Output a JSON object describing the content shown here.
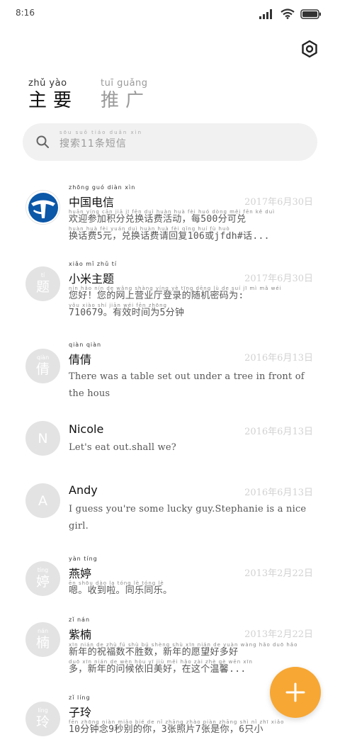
{
  "status_bar": {
    "time": "8:16",
    "icons": [
      "signal-icon",
      "wifi-icon",
      "battery-icon"
    ]
  },
  "header": {
    "settings_icon": "settings-icon"
  },
  "tabs": [
    {
      "pinyin": "zhǔ yào",
      "label": "主要"
    },
    {
      "pinyin": "tuī guǎng",
      "label": "推广"
    }
  ],
  "search": {
    "pinyin": "sōu suǒ    tiáo duǎn xìn",
    "placeholder": "搜索11条短信"
  },
  "messages": [
    {
      "avatar_text": "",
      "avatar_pinyin": "",
      "name_pinyin": "zhōng guó diàn xìn",
      "name": "中国电信",
      "date": "2017年6月30日",
      "preview_pinyin_1": "huān yíng cān jiā jī fēn duì huàn huà fèi huó dòng          měi              fēn kě duì",
      "preview_line_1": "欢迎参加积分兑换话费活动，每500分可兑",
      "preview_pinyin_2": "huàn huà fèi yuán   duì huàn huà fèi qǐng huí fù          huò",
      "preview_line_2": "换话费5元，兑换话费请回复106或jfdh#话..."
    },
    {
      "avatar_text": "题",
      "avatar_pinyin": "tí",
      "name_pinyin": "xiǎo mǐ zhǔ tí",
      "name": "小米主题",
      "date": "2017年6月30日",
      "preview_pinyin_1": "nín hǎo    nín de wǎng shàng yíng yè tīng dēng lù de suí jī mì mǎ wéi",
      "preview_line_1": "您好！您的网上营业厅登录的随机密码为:",
      "preview_pinyin_2": "          yǒu xiào shí jiān wéi    fēn zhōng",
      "preview_line_2": "710679。有效时间为5分钟"
    },
    {
      "avatar_text": "倩",
      "avatar_pinyin": "qiàn",
      "name_pinyin": "qiàn qiàn",
      "name": "倩倩",
      "date": "2016年6月13日",
      "preview_line_1": "There was a table set out under a tree in front of",
      "preview_line_2": "the hous"
    },
    {
      "avatar_text": "N",
      "name": "Nicole",
      "date": "2016年6月13日",
      "preview_line_1": "Let's eat out.shall we?"
    },
    {
      "avatar_text": "A",
      "name": "Andy",
      "date": "2016年6月13日",
      "preview_line_1": "I guess you're some lucky guy.Stephanie is a nice",
      "preview_line_2": "girl."
    },
    {
      "avatar_text": "婷",
      "avatar_pinyin": "tíng",
      "name_pinyin": "yàn tíng",
      "name": "燕婷",
      "date": "2013年2月22日",
      "preview_pinyin_1": "ēn   shōu dào la    tóng lè tóng lè",
      "preview_line_1": "嗯。收到啦。同乐同乐。"
    },
    {
      "avatar_text": "楠",
      "avatar_pinyin": "nán",
      "name_pinyin": "zǐ nán",
      "name": "紫楠",
      "date": "2013年2月22日",
      "preview_pinyin_1": "xīn nián de zhù fú shù bú shèng shù   xīn nián de yuàn wàng hǎo duō hǎo",
      "preview_line_1": "新年的祝福数不胜数，新年的愿望好多好",
      "preview_pinyin_2": "duō   xīn nián de wèn hòu yī jiù měi hǎo   zài zhè gè wēn xīn",
      "preview_line_2": "多，新年的问候依旧美好，在这个温馨..."
    },
    {
      "avatar_text": "玲",
      "avatar_pinyin": "líng",
      "name_pinyin": "zǐ líng",
      "name": "子玲",
      "date": "",
      "preview_pinyin_1": "fēn zhōng niàn   miǎo bié de nǐ   zhāng zhào piàn zhāng shì nǐ   zhī xiǎo",
      "preview_line_1": "10分钟念9秒别的你，3张照片7张是你，6只小"
    }
  ],
  "fab": {
    "icon": "plus-icon",
    "color": "#f7a733"
  },
  "colors": {
    "accent": "#f7a733",
    "telecom_blue": "#0b57a8",
    "avatar_bg": "#e3e3e3"
  }
}
